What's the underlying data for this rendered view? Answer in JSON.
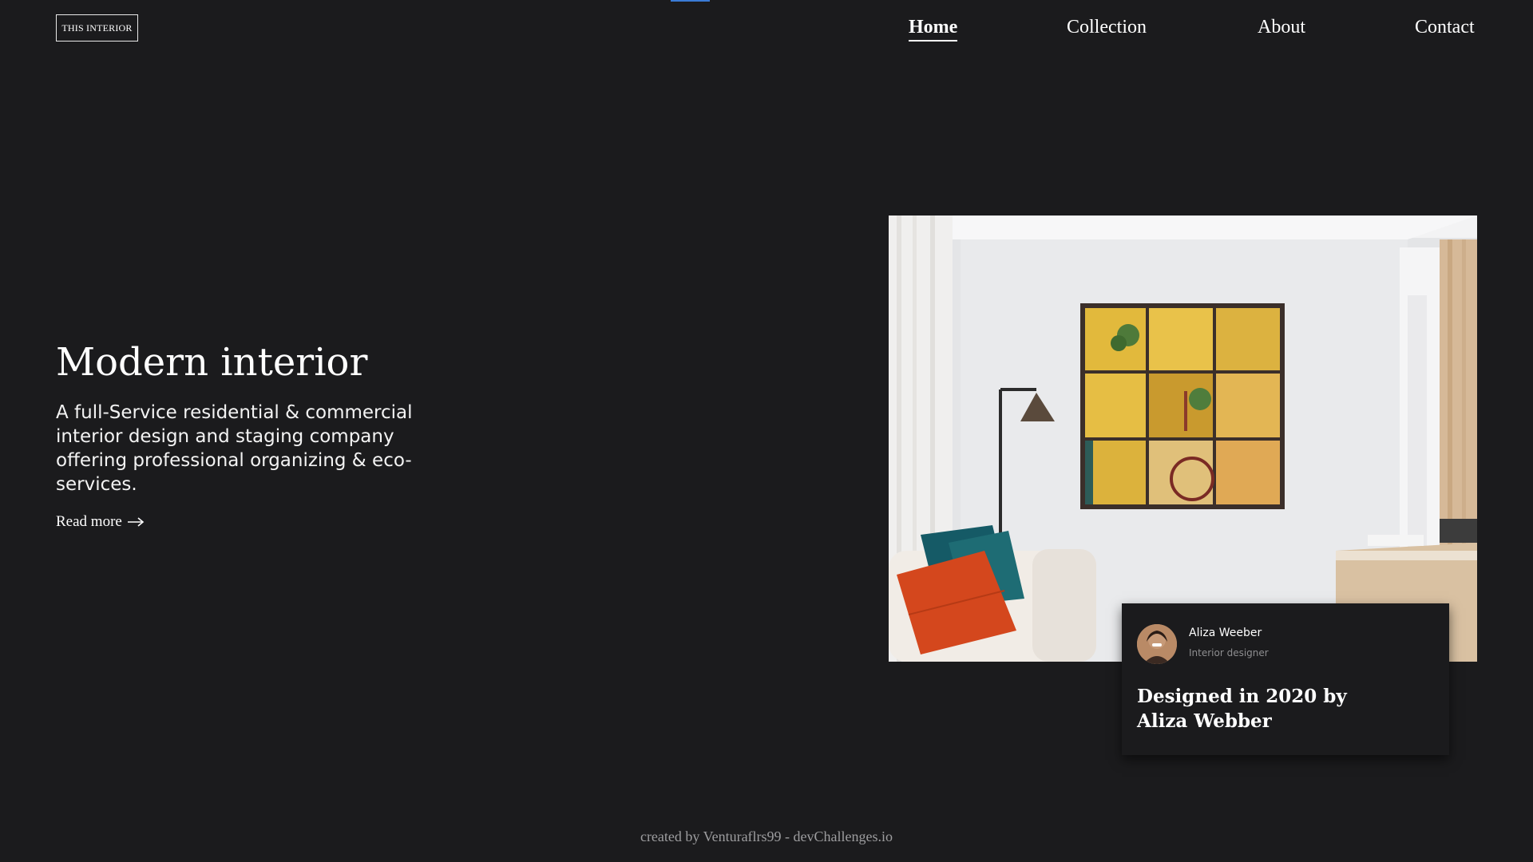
{
  "brand": {
    "logo_text": "THIS INTERIOR"
  },
  "nav": {
    "items": [
      {
        "label": "Home",
        "active": true
      },
      {
        "label": "Collection",
        "active": false
      },
      {
        "label": "About",
        "active": false
      },
      {
        "label": "Contact",
        "active": false
      }
    ]
  },
  "hero": {
    "title": "Modern interior",
    "description": "A full-Service residential & commercial interior design and staging company offering professional organizing & eco-services.",
    "read_more_label": "Read more",
    "read_more_icon": "arrow-right-icon"
  },
  "feature": {
    "image_name": "living-room-photo",
    "card": {
      "designer_name": "Aliza Weeber",
      "designer_role": "Interior designer",
      "title": "Designed in 2020 by Aliza Webber"
    }
  },
  "footer": {
    "credit": "created by Venturaflrs99 - devChallenges.io"
  },
  "colors": {
    "background": "#1b1b1d",
    "text": "#ffffff",
    "muted": "#9d9d9f",
    "top_accent": "#3a7bd5"
  }
}
